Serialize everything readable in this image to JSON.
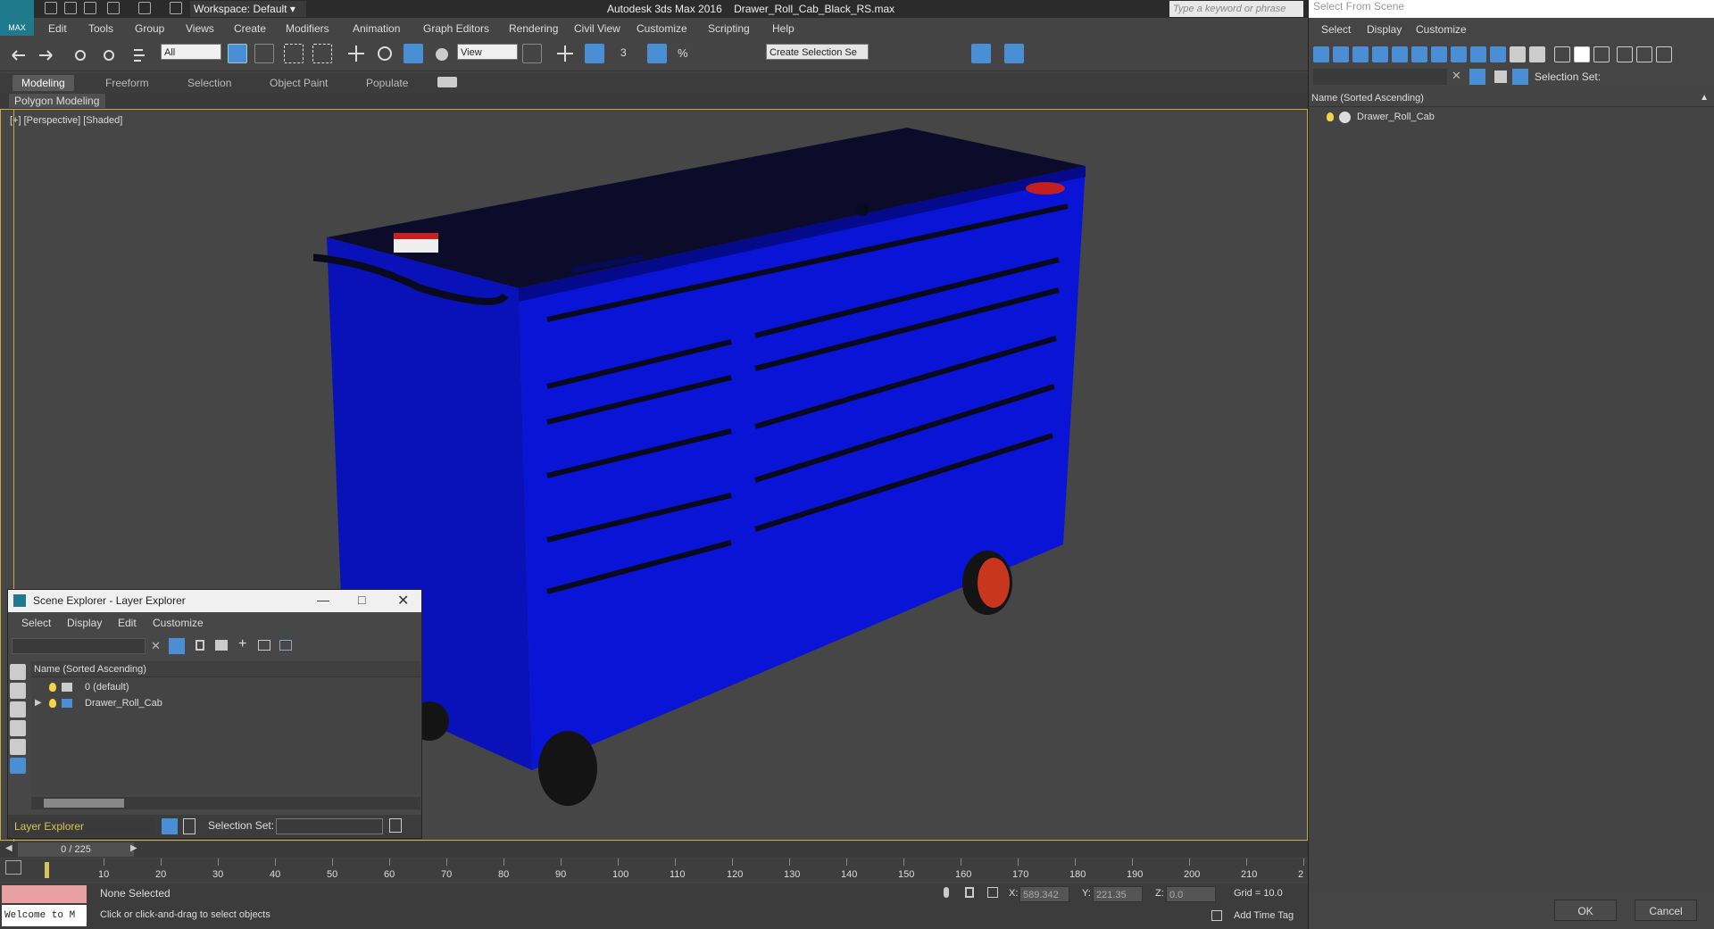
{
  "app": {
    "logo_label": "MAX",
    "workspace": "Workspace: Default",
    "title": "Autodesk 3ds Max 2016",
    "filename": "Drawer_Roll_Cab_Black_RS.max",
    "search_placeholder": "Type a keyword or phrase"
  },
  "menu": [
    "Edit",
    "Tools",
    "Group",
    "Views",
    "Create",
    "Modifiers",
    "Animation",
    "Graph Editors",
    "Rendering",
    "Civil View",
    "Customize",
    "Scripting",
    "Help"
  ],
  "toolbar": {
    "filter_value": "All",
    "view_value": "View",
    "selection_set_value": "Create Selection Se"
  },
  "ribbon": {
    "tabs": [
      "Modeling",
      "Freeform",
      "Selection",
      "Object Paint",
      "Populate"
    ],
    "active_tab": "Modeling",
    "sub_label": "Polygon Modeling"
  },
  "viewport": {
    "label": "[+] [Perspective] [Shaded]"
  },
  "scene_explorer": {
    "title": "Scene Explorer - Layer Explorer",
    "menu": [
      "Select",
      "Display",
      "Edit",
      "Customize"
    ],
    "header": "Name (Sorted Ascending)",
    "rows": [
      "0 (default)",
      "Drawer_Roll_Cab"
    ],
    "bottom_dropdown": "Layer Explorer",
    "selection_set_label": "Selection Set:"
  },
  "timeline": {
    "frame_counter": "0 / 225",
    "ticks": [
      "10",
      "20",
      "30",
      "40",
      "50",
      "60",
      "70",
      "80",
      "90",
      "100",
      "110",
      "120",
      "130",
      "140",
      "150",
      "160",
      "170",
      "180",
      "190",
      "200",
      "210",
      "2"
    ]
  },
  "status": {
    "welcome": "Welcome to M",
    "selection": "None Selected",
    "prompt": "Click or click-and-drag to select objects",
    "x_label": "X:",
    "x_value": "589.342",
    "y_label": "Y:",
    "y_value": "221.35",
    "z_label": "Z:",
    "z_value": "0.0",
    "grid": "Grid = 10.0",
    "add_time_tag": "Add Time Tag"
  },
  "select_from_scene": {
    "title": "Select From Scene",
    "menu": [
      "Select",
      "Display",
      "Customize"
    ],
    "selection_set_label": "Selection Set:",
    "header": "Name (Sorted Ascending)",
    "rows": [
      "Drawer_Roll_Cab"
    ],
    "ok_label": "OK",
    "cancel_label": "Cancel"
  },
  "colors": {
    "cabinet_blue": "#0a14d6",
    "wheel_red": "#c8361e",
    "viewport_bg": "#464646",
    "selection_border": "#c8a94a"
  }
}
